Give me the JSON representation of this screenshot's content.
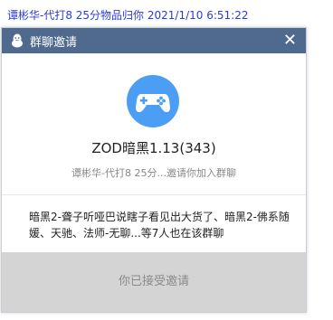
{
  "notification": {
    "text": "谭彬华-代打8 25分物品归你 2021/1/10 6:51:22"
  },
  "dialog": {
    "title": "群聊邀请",
    "close": "✕",
    "group_name": "ZOD暗黑1.13(343)",
    "invite_text": "谭彬华-代打8 25分...邀请你加入群聊",
    "members_text": "暗黑2-聋子听哑巴说瞎子看见出大货了、暗黑2-佛系随媛、天驰、法师-无聊...等7人也在该群聊",
    "accept_button": "你已接受邀请",
    "colors": {
      "titlebar": "#506a8f",
      "accent_icon": "#4c9df4",
      "footer": "#d4d4d4"
    },
    "icons": {
      "title_icon": "penguin-icon",
      "group_icon": "gamepad-icon"
    }
  }
}
